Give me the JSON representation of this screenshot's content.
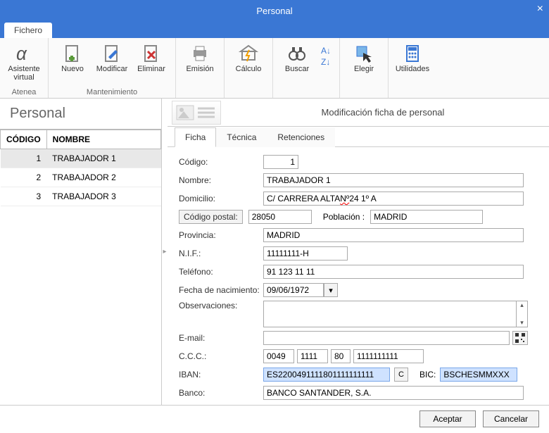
{
  "window": {
    "title": "Personal"
  },
  "ribbon": {
    "tab": "Fichero",
    "asistente": {
      "line1": "Asistente",
      "line2": "virtual",
      "caption": "Atenea"
    },
    "nuevo": "Nuevo",
    "modificar": "Modificar",
    "eliminar": "Eliminar",
    "mantenimiento_caption": "Mantenimiento",
    "emision": "Emisión",
    "calculo": "Cálculo",
    "buscar": "Buscar",
    "elegir": "Elegir",
    "utilidades": "Utilidades"
  },
  "left": {
    "title": "Personal",
    "columns": {
      "codigo": "CÓDIGO",
      "nombre": "NOMBRE"
    },
    "rows": [
      {
        "codigo": "1",
        "nombre": "TRABAJADOR 1"
      },
      {
        "codigo": "2",
        "nombre": "TRABAJADOR 2"
      },
      {
        "codigo": "3",
        "nombre": "TRABAJADOR 3"
      }
    ]
  },
  "detail": {
    "subtitle": "Modificación ficha de personal",
    "tabs": {
      "ficha": "Ficha",
      "tecnica": "Técnica",
      "retenciones": "Retenciones"
    },
    "labels": {
      "codigo": "Código:",
      "nombre": "Nombre:",
      "domicilio": "Domicilio:",
      "codigo_postal_btn": "Código postal:",
      "poblacion": "Población :",
      "provincia": "Provincia:",
      "nif": "N.I.F.:",
      "telefono": "Teléfono:",
      "fecha_nac": "Fecha de nacimiento:",
      "observaciones": "Observaciones:",
      "email": "E-mail:",
      "ccc": "C.C.C.:",
      "iban": "IBAN:",
      "bic": "BIC:",
      "banco": "Banco:"
    },
    "values": {
      "codigo": "1",
      "nombre": "TRABAJADOR 1",
      "domicilio_pre": "C/ CARRERA ALTA ",
      "domicilio_mid": "Nº",
      "domicilio_post": " 24 1º A",
      "cp": "28050",
      "poblacion": "MADRID",
      "provincia": "MADRID",
      "nif": "11111111-H",
      "telefono": "91 123 11 11",
      "fecha_nac": "09/06/1972",
      "observaciones": "",
      "email": "",
      "ccc": {
        "a": "0049",
        "b": "1111",
        "c": "80",
        "d": "1111111111"
      },
      "iban": "ES2200491111801111111111",
      "iban_btn": "C",
      "bic": "BSCHESMMXXX",
      "banco": "BANCO SANTANDER, S.A."
    }
  },
  "footer": {
    "accept": "Aceptar",
    "cancel": "Cancelar"
  }
}
